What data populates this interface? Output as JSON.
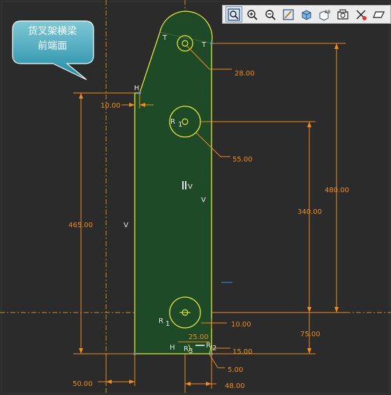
{
  "callout": {
    "line1": "货叉架横梁",
    "line2": "前端面"
  },
  "toolbar": {
    "buttons": [
      {
        "name": "zoom-fit-icon"
      },
      {
        "name": "zoom-in-icon"
      },
      {
        "name": "zoom-out-icon"
      },
      {
        "name": "repaint-icon"
      },
      {
        "name": "display-style-icon"
      },
      {
        "name": "saved-views-icon"
      },
      {
        "name": "sketch-view-icon"
      },
      {
        "name": "datum-display-icon"
      },
      {
        "name": "annotation-display-icon"
      }
    ]
  },
  "dimensions": {
    "top_radius": "28.00",
    "circle_diameter": "55.00",
    "total_height": "480.00",
    "mid_to_bottom": "340.00",
    "left_height": "465.00",
    "step_width": "10.00",
    "bottom_width": "50.00",
    "bottom_right_offset": "48.00",
    "bottom_circle_height": "75.00",
    "small_right": "10.00",
    "small_offset": "15.00",
    "small_width": "25.00",
    "small_bottom": "5.00"
  },
  "constraints": {
    "t1": "T",
    "t2": "T",
    "h_top": "H",
    "r_mid": "R",
    "r_mid_sub": "1",
    "v_center": "V",
    "v_right": "V",
    "v_left": "V",
    "r1": "R",
    "r1_sub": "1",
    "h_bottom": "H",
    "r3": "R",
    "r3_sub": "3",
    "r2": "R",
    "r2_sub": "2"
  },
  "colors": {
    "background": "#2b2b2b",
    "part_fill": "#1f4a28",
    "outline": "#e6ea3a",
    "dimension": "#f28c1e",
    "constraint": "#e8e8e8"
  }
}
